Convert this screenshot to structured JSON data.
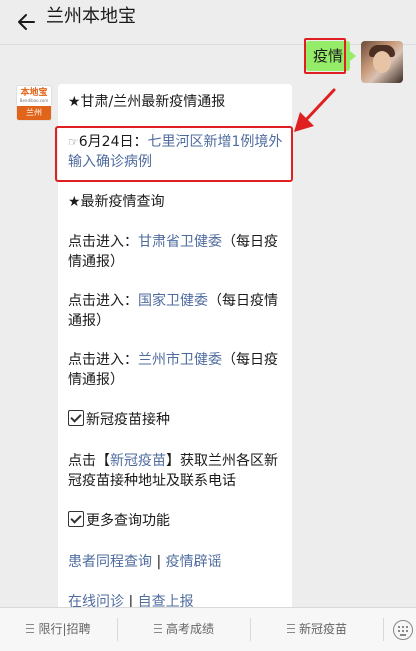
{
  "header": {
    "title": "兰州本地宝"
  },
  "user_message": {
    "text": "疫情"
  },
  "bot_avatar": {
    "logo_text": "本地宝",
    "domain_text": "Bendibao.com",
    "city_text": "兰州"
  },
  "message": {
    "heading": "★甘肃/兰州最新疫情通报",
    "update_date": "6月24日：",
    "update_link": "七里河区新增1例境外输入确诊病例",
    "query_heading": "★最新疫情查询",
    "click_prefix": "点击进入：",
    "gansu_link": "甘肃省卫健委",
    "gansu_suffix": "（每日疫情通报）",
    "national_link": "国家卫健委",
    "national_suffix": "（每日疫情通报）",
    "lanzhou_link": "兰州市卫健委",
    "lanzhou_suffix": "（每日疫情通报）",
    "vaccine_heading": "新冠疫苗接种",
    "vaccine_pre": "点击【",
    "vaccine_link": "新冠疫苗",
    "vaccine_post": "】获取兰州各区新冠疫苗接种地址及联系电话",
    "more_heading": "更多查询功能",
    "links_row1": [
      "患者同程查询",
      "疫情辟谣"
    ],
    "links_row2": [
      "在线问诊",
      "自查上报"
    ],
    "separator": "|"
  },
  "bottom_tabs": [
    "限行|招聘",
    "高考成绩",
    "新冠疫苗"
  ],
  "colors": {
    "background": "#ededed",
    "user_bubble": "#95ec69",
    "link": "#4f6c9f",
    "highlight": "#e02020",
    "brand": "#e0651a"
  }
}
